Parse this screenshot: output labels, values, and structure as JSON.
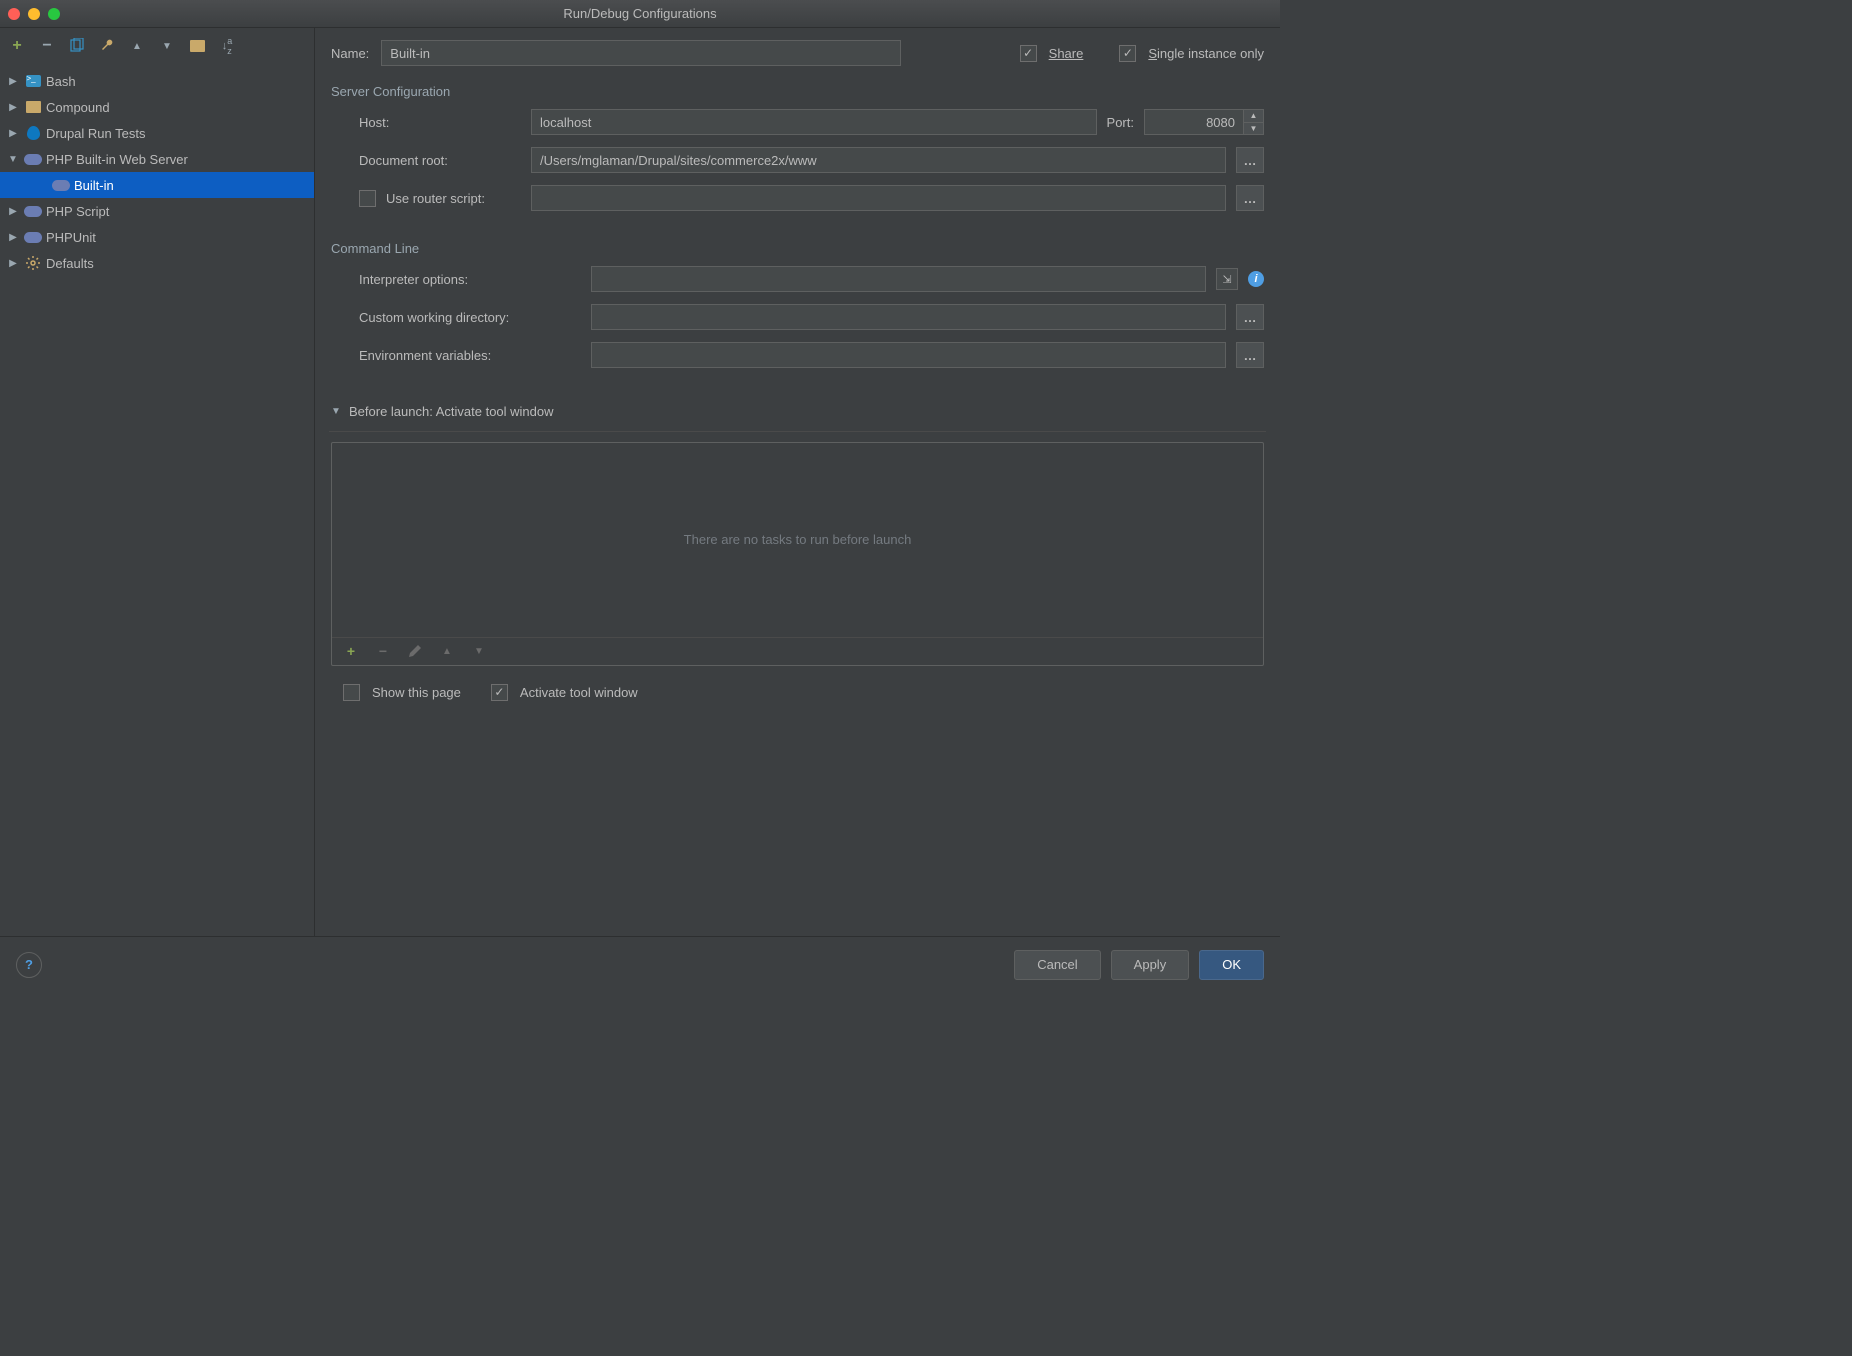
{
  "window": {
    "title": "Run/Debug Configurations"
  },
  "sidebar": {
    "tree": [
      {
        "label": "Bash",
        "expanded": false,
        "icon": "terminal"
      },
      {
        "label": "Compound",
        "expanded": false,
        "icon": "folder"
      },
      {
        "label": "Drupal Run Tests",
        "expanded": false,
        "icon": "drupal"
      },
      {
        "label": "PHP Built-in Web Server",
        "expanded": true,
        "icon": "php",
        "children": [
          {
            "label": "Built-in",
            "icon": "php-run",
            "selected": true
          }
        ]
      },
      {
        "label": "PHP Script",
        "expanded": false,
        "icon": "php"
      },
      {
        "label": "PHPUnit",
        "expanded": false,
        "icon": "php"
      },
      {
        "label": "Defaults",
        "expanded": false,
        "icon": "gear"
      }
    ]
  },
  "form": {
    "name_label": "Name:",
    "name_value": "Built-in",
    "share_label": "Share",
    "share_checked": true,
    "single_instance_label": "Single instance only",
    "single_instance_checked": true,
    "server_section": "Server Configuration",
    "host_label": "Host:",
    "host_value": "localhost",
    "port_label": "Port:",
    "port_value": "8080",
    "docroot_label": "Document root:",
    "docroot_value": "/Users/mglaman/Drupal/sites/commerce2x/www",
    "use_router_label": "Use router script:",
    "use_router_checked": false,
    "router_value": "",
    "cmdline_section": "Command Line",
    "interp_label": "Interpreter options:",
    "interp_value": "",
    "cwd_label": "Custom working directory:",
    "cwd_value": "",
    "env_label": "Environment variables:",
    "env_value": "",
    "before_launch_header": "Before launch: Activate tool window",
    "before_launch_empty": "There are no tasks to run before launch",
    "show_page_label": "Show this page",
    "show_page_checked": false,
    "activate_tw_label": "Activate tool window",
    "activate_tw_checked": true
  },
  "buttons": {
    "cancel": "Cancel",
    "apply": "Apply",
    "ok": "OK"
  }
}
